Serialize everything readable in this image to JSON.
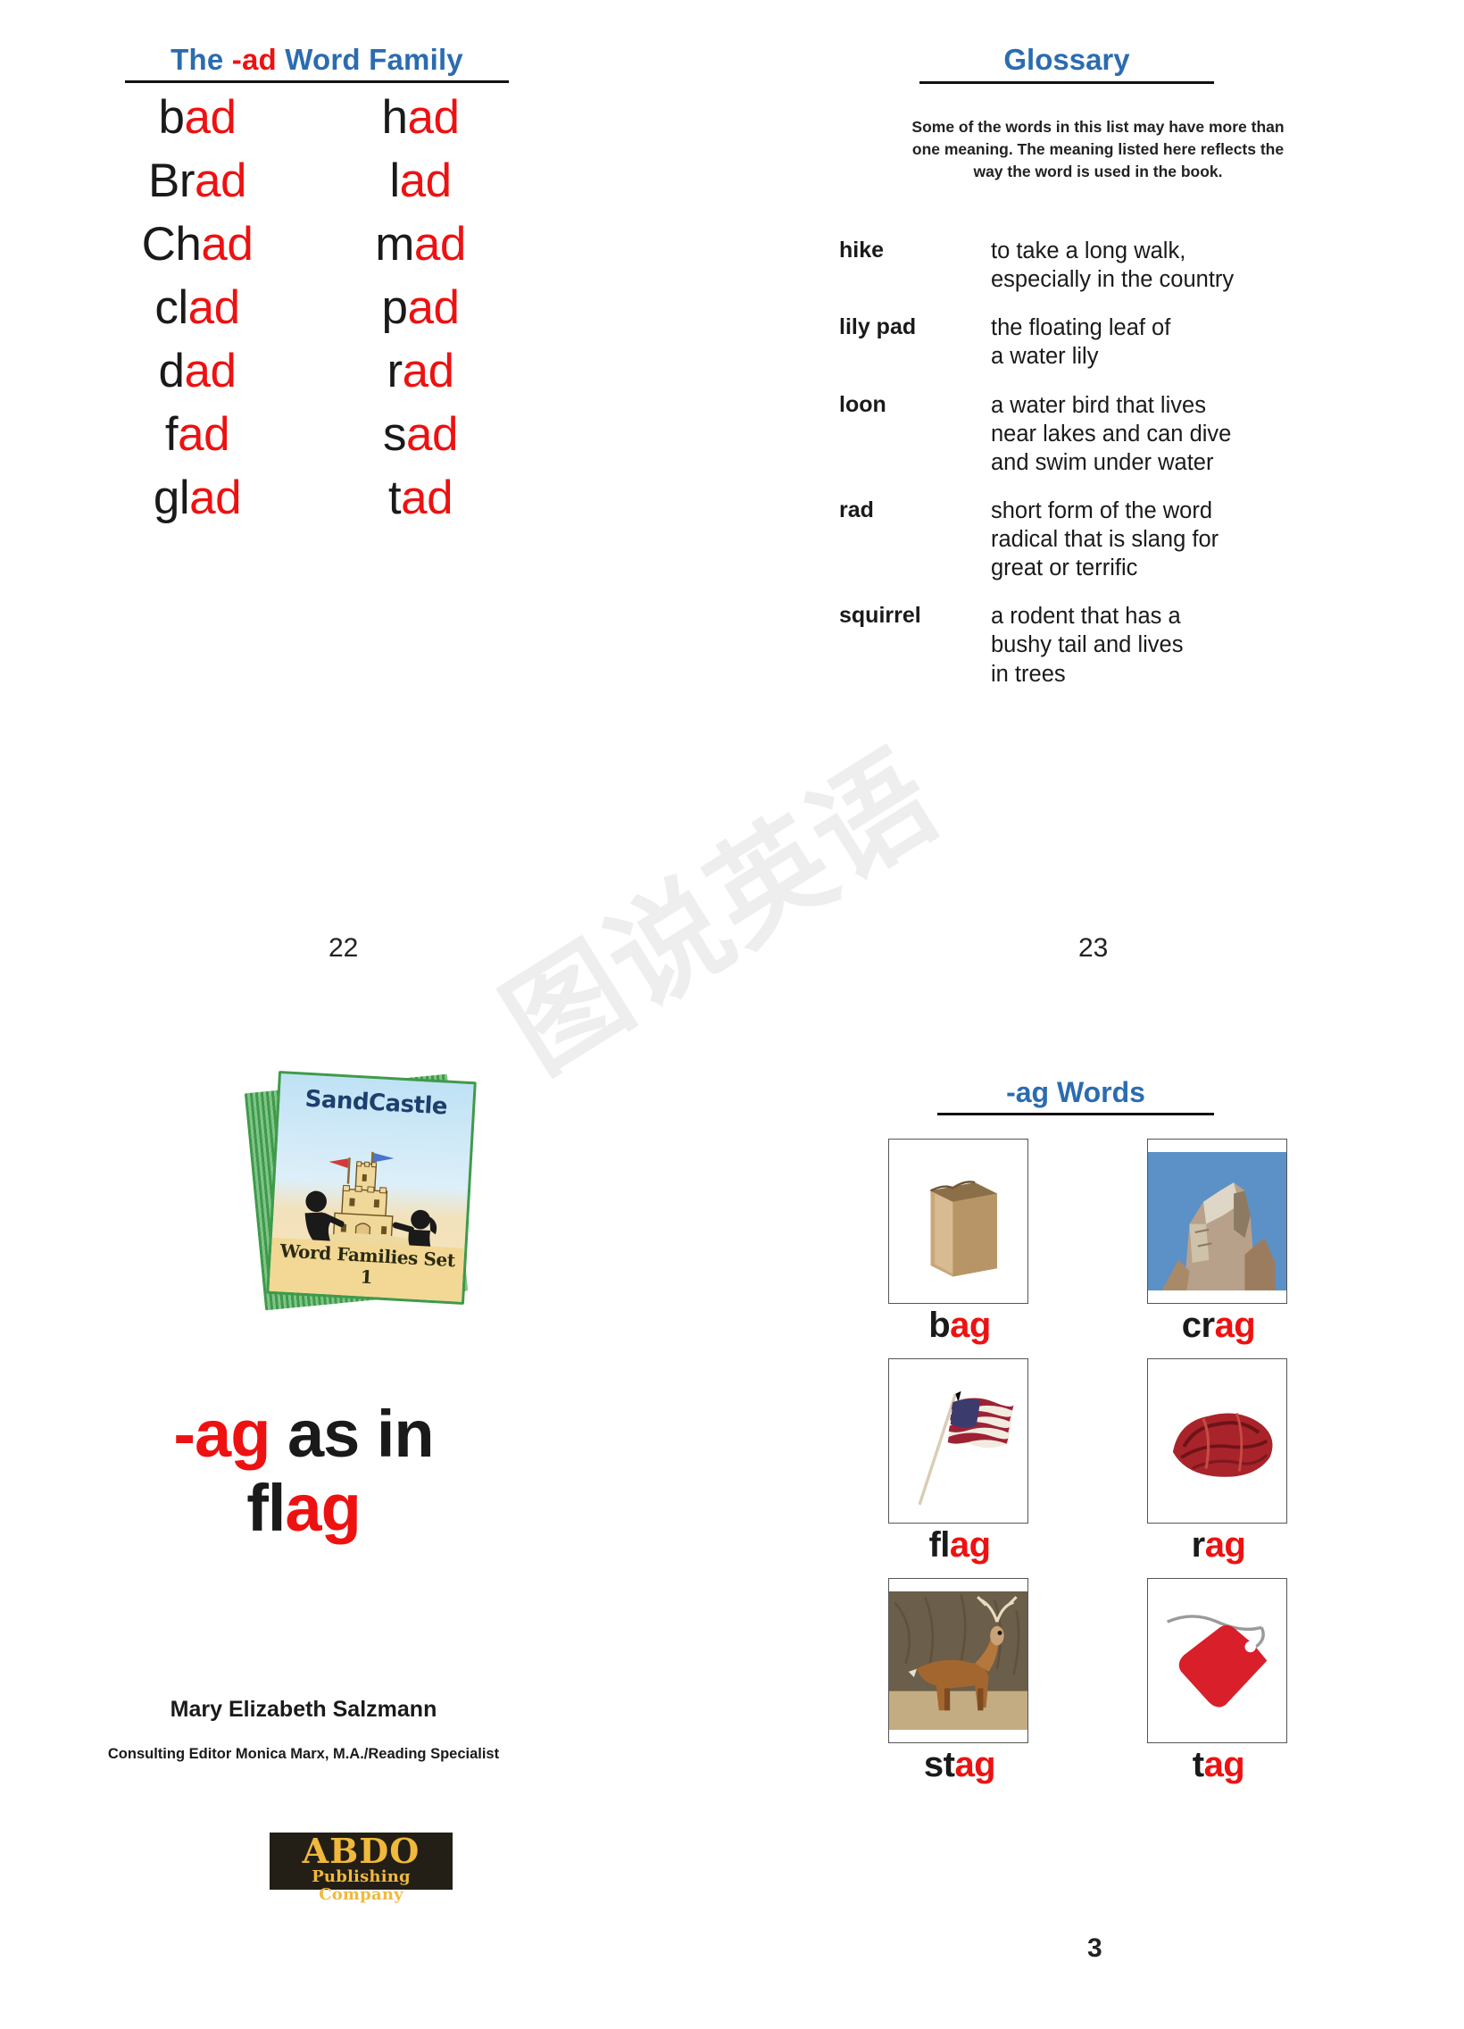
{
  "ad_family": {
    "title_parts": [
      {
        "t": "The ",
        "c": "blue"
      },
      {
        "t": "-ad",
        "c": "red"
      },
      {
        "t": " Word Family",
        "c": "blue"
      }
    ],
    "title_plain": "The -ad Word Family",
    "rows": [
      [
        {
          "onset": "b",
          "rime": "ad"
        },
        {
          "onset": "h",
          "rime": "ad"
        }
      ],
      [
        {
          "onset": "Br",
          "rime": "ad"
        },
        {
          "onset": "l",
          "rime": "ad"
        }
      ],
      [
        {
          "onset": "Ch",
          "rime": "ad"
        },
        {
          "onset": "m",
          "rime": "ad"
        }
      ],
      [
        {
          "onset": "cl",
          "rime": "ad"
        },
        {
          "onset": "p",
          "rime": "ad"
        }
      ],
      [
        {
          "onset": "d",
          "rime": "ad"
        },
        {
          "onset": "r",
          "rime": "ad"
        }
      ],
      [
        {
          "onset": "f",
          "rime": "ad"
        },
        {
          "onset": "s",
          "rime": "ad"
        }
      ],
      [
        {
          "onset": "gl",
          "rime": "ad"
        },
        {
          "onset": "t",
          "rime": "ad"
        }
      ]
    ]
  },
  "glossary": {
    "title": "Glossary",
    "intro": "Some of the words in this list may have more than one meaning. The meaning listed here reflects the way the word is used in the book.",
    "entries": [
      {
        "term": "hike",
        "definition": "to take a long walk,\nespecially in the country"
      },
      {
        "term": "lily pad",
        "definition": "the floating leaf of\na water lily"
      },
      {
        "term": "loon",
        "definition": "a water bird that lives\nnear lakes and can dive\nand swim under water"
      },
      {
        "term": "rad",
        "definition": "short form of the word\nradical that is slang for\ngreat or terrific"
      },
      {
        "term": "squirrel",
        "definition": "a rodent that has a\nbushy tail and lives\nin trees"
      }
    ]
  },
  "page_numbers": {
    "left_spread_left": "22",
    "left_spread_right": "23",
    "bottom_right": "3"
  },
  "watermark": {
    "text": "图说英语"
  },
  "cover": {
    "title": "SandCastle",
    "subtitle": "Word Families Set 1"
  },
  "title_page": {
    "heading_parts": [
      {
        "t": "-",
        "c": "red"
      },
      {
        "t": "ag",
        "c": "red"
      },
      {
        "t": " as in",
        "c": "black"
      },
      {
        "t": "\n",
        "c": "black"
      },
      {
        "t": "fl",
        "c": "black"
      },
      {
        "t": "ag",
        "c": "red"
      }
    ],
    "heading_line1_onset": "-",
    "heading_line1_rime": "ag",
    "heading_line1_tail": " as in",
    "heading_line2_onset": "fl",
    "heading_line2_rime": "ag",
    "author": "Mary Elizabeth Salzmann",
    "editor": "Consulting Editor Monica Marx, M.A./Reading Specialist",
    "publisher_main": "ABDO",
    "publisher_sub": "Publishing Company"
  },
  "ag_words": {
    "title": "-ag Words",
    "rows": [
      [
        {
          "onset": "b",
          "rime": "ag",
          "image": "paper-bag-photo"
        },
        {
          "onset": "cr",
          "rime": "ag",
          "image": "rock-crag-photo"
        }
      ],
      [
        {
          "onset": "fl",
          "rime": "ag",
          "image": "american-flag-photo"
        },
        {
          "onset": "r",
          "rime": "ag",
          "image": "red-rag-photo"
        }
      ],
      [
        {
          "onset": "st",
          "rime": "ag",
          "image": "stag-deer-photo"
        },
        {
          "onset": "t",
          "rime": "ag",
          "image": "red-price-tag-photo"
        }
      ]
    ]
  },
  "colors": {
    "rime_red": "#ee1111",
    "header_blue": "#2b6cb0",
    "text_black": "#1a1a1a",
    "publisher_gold": "#f0b93c"
  }
}
